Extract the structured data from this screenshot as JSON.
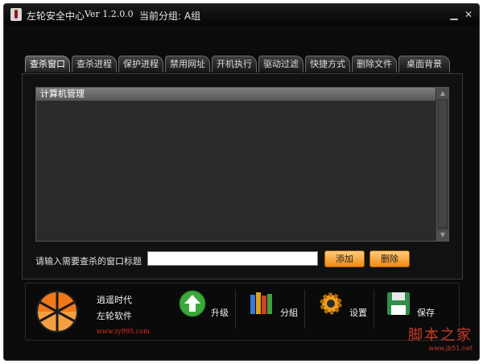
{
  "window": {
    "title": "左轮安全中心",
    "version": "Ver 1.2.0.0",
    "group": "当前分组: A组",
    "minimize_icon": "minimize-icon",
    "close_icon": "close-icon"
  },
  "tabs": [
    {
      "label": "查杀窗口",
      "active": true
    },
    {
      "label": "查杀进程",
      "active": false
    },
    {
      "label": "保护进程",
      "active": false
    },
    {
      "label": "禁用网址",
      "active": false
    },
    {
      "label": "开机执行",
      "active": false
    },
    {
      "label": "驱动过滤",
      "active": false
    },
    {
      "label": "快捷方式",
      "active": false
    },
    {
      "label": "删除文件",
      "active": false
    },
    {
      "label": "桌面背景",
      "active": false
    }
  ],
  "list": {
    "header": "计算机管理",
    "rows": []
  },
  "input": {
    "label": "请输入需要查杀的窗口标题",
    "value": "",
    "placeholder": ""
  },
  "buttons": {
    "add": "添加",
    "delete": "删除"
  },
  "footer": {
    "brand_line1": "逍遥时代",
    "brand_line2": "左轮软件",
    "url": "www.zy995.com",
    "tools": [
      {
        "label": "升级",
        "icon": "upgrade-arrow-icon"
      },
      {
        "label": "分組",
        "icon": "books-icon"
      },
      {
        "label": "设置",
        "icon": "gear-icon"
      },
      {
        "label": "保存",
        "icon": "floppy-disk-icon"
      }
    ]
  },
  "watermark": {
    "main": "脚本之家",
    "sub": "www.jb51.net"
  },
  "colors": {
    "background": "#0b0b0b",
    "button_orange": "#f08a10",
    "url_red": "#e03020"
  }
}
